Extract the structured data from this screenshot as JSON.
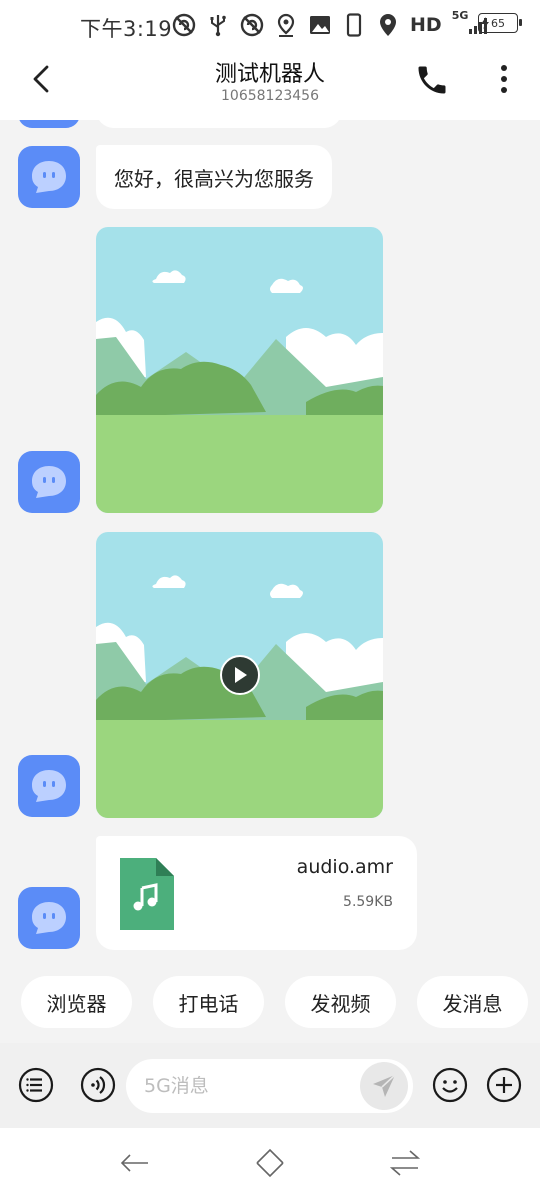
{
  "status_bar": {
    "time": "下午3:19",
    "hd": "HD",
    "network": "5G",
    "battery": "65"
  },
  "header": {
    "title": "测试机器人",
    "subtitle": "10658123456"
  },
  "messages": {
    "greeting": "您好，很高兴为您服务",
    "file": {
      "name": "audio.amr",
      "size": "5.59KB"
    }
  },
  "quick_replies": [
    "浏览器",
    "打电话",
    "发视频",
    "发消息"
  ],
  "composer": {
    "placeholder": "5G消息"
  },
  "colors": {
    "avatar": "#5b8cf7",
    "sky": "#a5e1ea",
    "grass": "#9bd67e",
    "file_icon": "#4caf7c"
  },
  "icons": {
    "back": "back-arrow-icon",
    "call": "phone-icon",
    "more": "more-vertical-icon",
    "menu": "list-menu-icon",
    "voice": "voice-icon",
    "send": "send-icon",
    "emoji": "emoji-icon",
    "add": "add-icon",
    "play": "play-icon",
    "music_file": "music-file-icon"
  }
}
